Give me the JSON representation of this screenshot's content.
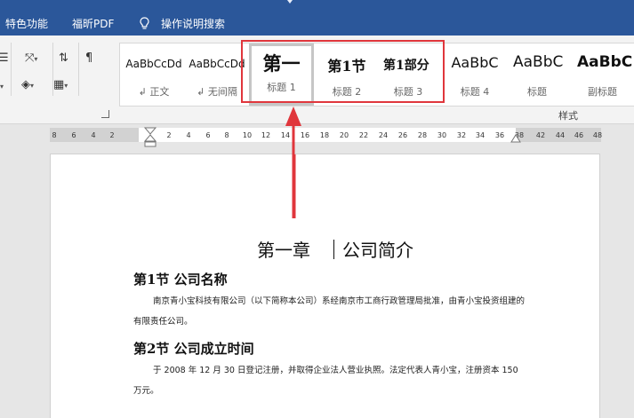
{
  "menubar": {
    "items": [
      "特色功能",
      "福昕PDF",
      "操作说明搜索"
    ]
  },
  "ribbon": {
    "styles": [
      {
        "preview": "AaBbCcDd",
        "label": "↲ 正文"
      },
      {
        "preview": "AaBbCcDd",
        "label": "↲ 无间隔"
      },
      {
        "preview": "第一",
        "label": "标题 1"
      },
      {
        "preview": "第1节",
        "label": "标题 2"
      },
      {
        "preview": "第1部分",
        "label": "标题 3"
      },
      {
        "preview": "AaBbC",
        "label": "标题 4"
      },
      {
        "preview": "AaBbC",
        "label": "标题"
      },
      {
        "preview": "AaBbC",
        "label": "副标题"
      }
    ],
    "group_label": "样式"
  },
  "ruler": {
    "ticks": [
      "8",
      "6",
      "4",
      "2",
      "2",
      "4",
      "6",
      "8",
      "10",
      "12",
      "14",
      "16",
      "18",
      "20",
      "22",
      "24",
      "26",
      "28",
      "30",
      "32",
      "34",
      "36",
      "38",
      "42",
      "44",
      "46",
      "48"
    ]
  },
  "document": {
    "title_part1": "第一章",
    "title_part2": "公司简介",
    "section1_heading": "第1节  公司名称",
    "section1_text": "南京青小宝科技有限公司（以下简称本公司）系经南京市工商行政管理局批准，由青小宝投资组建的有限责任公司。",
    "section2_heading": "第2节  公司成立时间",
    "section2_text": "于 2008 年 12 月 30 日登记注册，并取得企业法人营业执照。法定代表人青小宝，注册资本 150 万元。"
  },
  "colors": {
    "menubar": "#2b579a",
    "highlight": "#e0363c",
    "arrow": "#e0363c"
  }
}
